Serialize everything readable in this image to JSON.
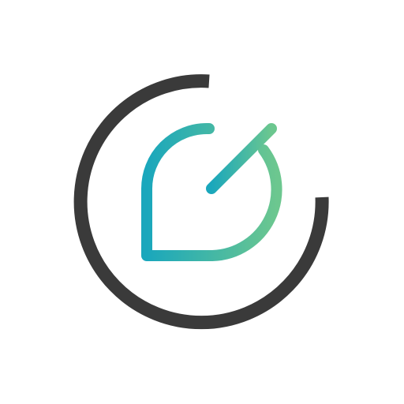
{
  "logo": {
    "name": "app-logo",
    "colors": {
      "ring": "#3a3a3a",
      "gradient_start": "#1aa7bc",
      "gradient_end": "#6cc78f",
      "background": "#ffffff"
    }
  }
}
